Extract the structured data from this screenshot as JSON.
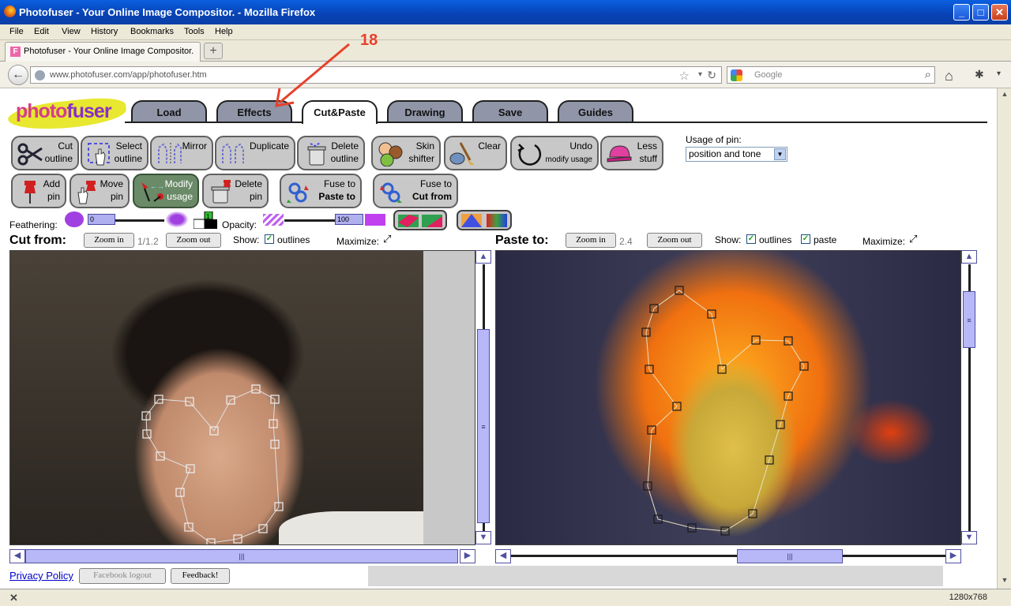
{
  "browser": {
    "window_title": "Photofuser - Your Online Image Compositor. - Mozilla Firefox",
    "menu": [
      "File",
      "Edit",
      "View",
      "History",
      "Bookmarks",
      "Tools",
      "Help"
    ],
    "tab_title": "Photofuser - Your Online Image Compositor.",
    "url": "www.photofuser.com/app/photofuser.htm",
    "search_placeholder": "Google",
    "status_text": "1280x768"
  },
  "annotation": "18",
  "logo": {
    "part1": "photo",
    "part2": "fuser"
  },
  "app_tabs": [
    "Load",
    "Effects",
    "Cut&Paste",
    "Drawing",
    "Save",
    "Guides"
  ],
  "active_tab": "Cut&Paste",
  "tools_row1": [
    {
      "line1": "Cut",
      "line2": "outline",
      "icon": "scissors-icon"
    },
    {
      "line1": "Select",
      "line2": "outline",
      "icon": "select-hand-icon"
    },
    {
      "line1": "Mirror",
      "line2": "",
      "icon": "mirror-icon"
    },
    {
      "line1": "Duplicate",
      "line2": "",
      "icon": "duplicate-icon"
    },
    {
      "line1": "Delete",
      "line2": "outline",
      "icon": "trash-icon"
    },
    {
      "line1": "Skin",
      "line2": "shifter",
      "icon": "faces-icon"
    },
    {
      "line1": "Clear",
      "line2": "",
      "icon": "broom-bucket-icon"
    },
    {
      "line1": "Undo",
      "line2": "modify usage",
      "icon": "undo-arrow-icon"
    },
    {
      "line1": "Less",
      "line2": "stuff",
      "icon": "cap-icon"
    }
  ],
  "tools_row2": [
    {
      "line1": "Add",
      "line2": "pin",
      "icon": "pin-icon"
    },
    {
      "line1": "Move",
      "line2": "pin",
      "icon": "move-pin-icon"
    },
    {
      "line1": "Modify",
      "line2": "usage",
      "icon": "modify-pin-icon"
    },
    {
      "line1": "Delete",
      "line2": "pin",
      "icon": "delete-pin-icon"
    },
    {
      "line1": "Fuse to",
      "line2": "Paste to",
      "icon": "fuse-icon"
    },
    {
      "line1": "Fuse to",
      "line2": "Cut from",
      "icon": "fuse-icon"
    }
  ],
  "pin_usage": {
    "label": "Usage of pin:",
    "selected": "position and tone"
  },
  "feathering": {
    "label": "Feathering:",
    "value": "0"
  },
  "opacity": {
    "label": "Opacity:",
    "value": "100"
  },
  "cut_panel": {
    "title": "Cut from:",
    "zoom_in": "Zoom in",
    "zoom_value": "1/1.2",
    "zoom_out": "Zoom out",
    "show_label": "Show:",
    "outlines_label": "outlines",
    "outlines_checked": true,
    "maximize_label": "Maximize:"
  },
  "paste_panel": {
    "title": "Paste to:",
    "zoom_in": "Zoom in",
    "zoom_value": "2.4",
    "zoom_out": "Zoom out",
    "show_label": "Show:",
    "outlines_label": "outlines",
    "outlines_checked": true,
    "paste_label": "paste",
    "paste_checked": true,
    "maximize_label": "Maximize:"
  },
  "footer": {
    "privacy": "Privacy Policy",
    "facebook_logout": "Facebook logout",
    "feedback": "Feedback!"
  },
  "colors": {
    "tab_inactive": "#9095a8",
    "tool_button": "#c8c8c8",
    "tool_button_active": "#6a8a68",
    "scroll_thumb": "#b8b8f8",
    "annotation": "#e8402a"
  }
}
